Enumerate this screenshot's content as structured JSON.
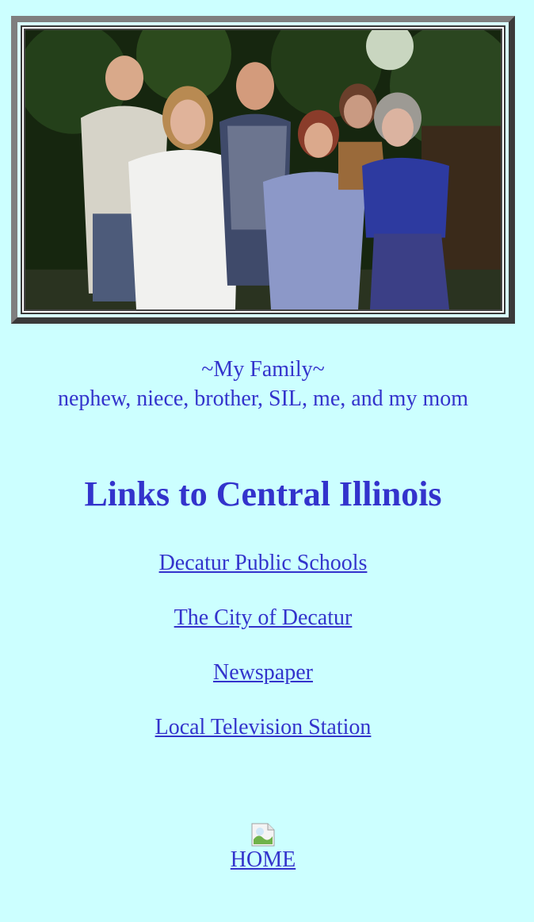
{
  "photo": {
    "alt": "family photo"
  },
  "caption": {
    "line1": "~My Family~",
    "line2": "nephew, niece, brother, SIL, me, and my mom"
  },
  "heading": "Links to Central Illinois",
  "links": [
    {
      "label": "Decatur Public Schools"
    },
    {
      "label": "The City of Decatur"
    },
    {
      "label": "Newspaper"
    },
    {
      "label": "Local Television Station"
    }
  ],
  "home": {
    "label": "HOME",
    "image": "broken-image-icon"
  },
  "colors": {
    "background": "#ccffff",
    "text": "#3333cc"
  }
}
